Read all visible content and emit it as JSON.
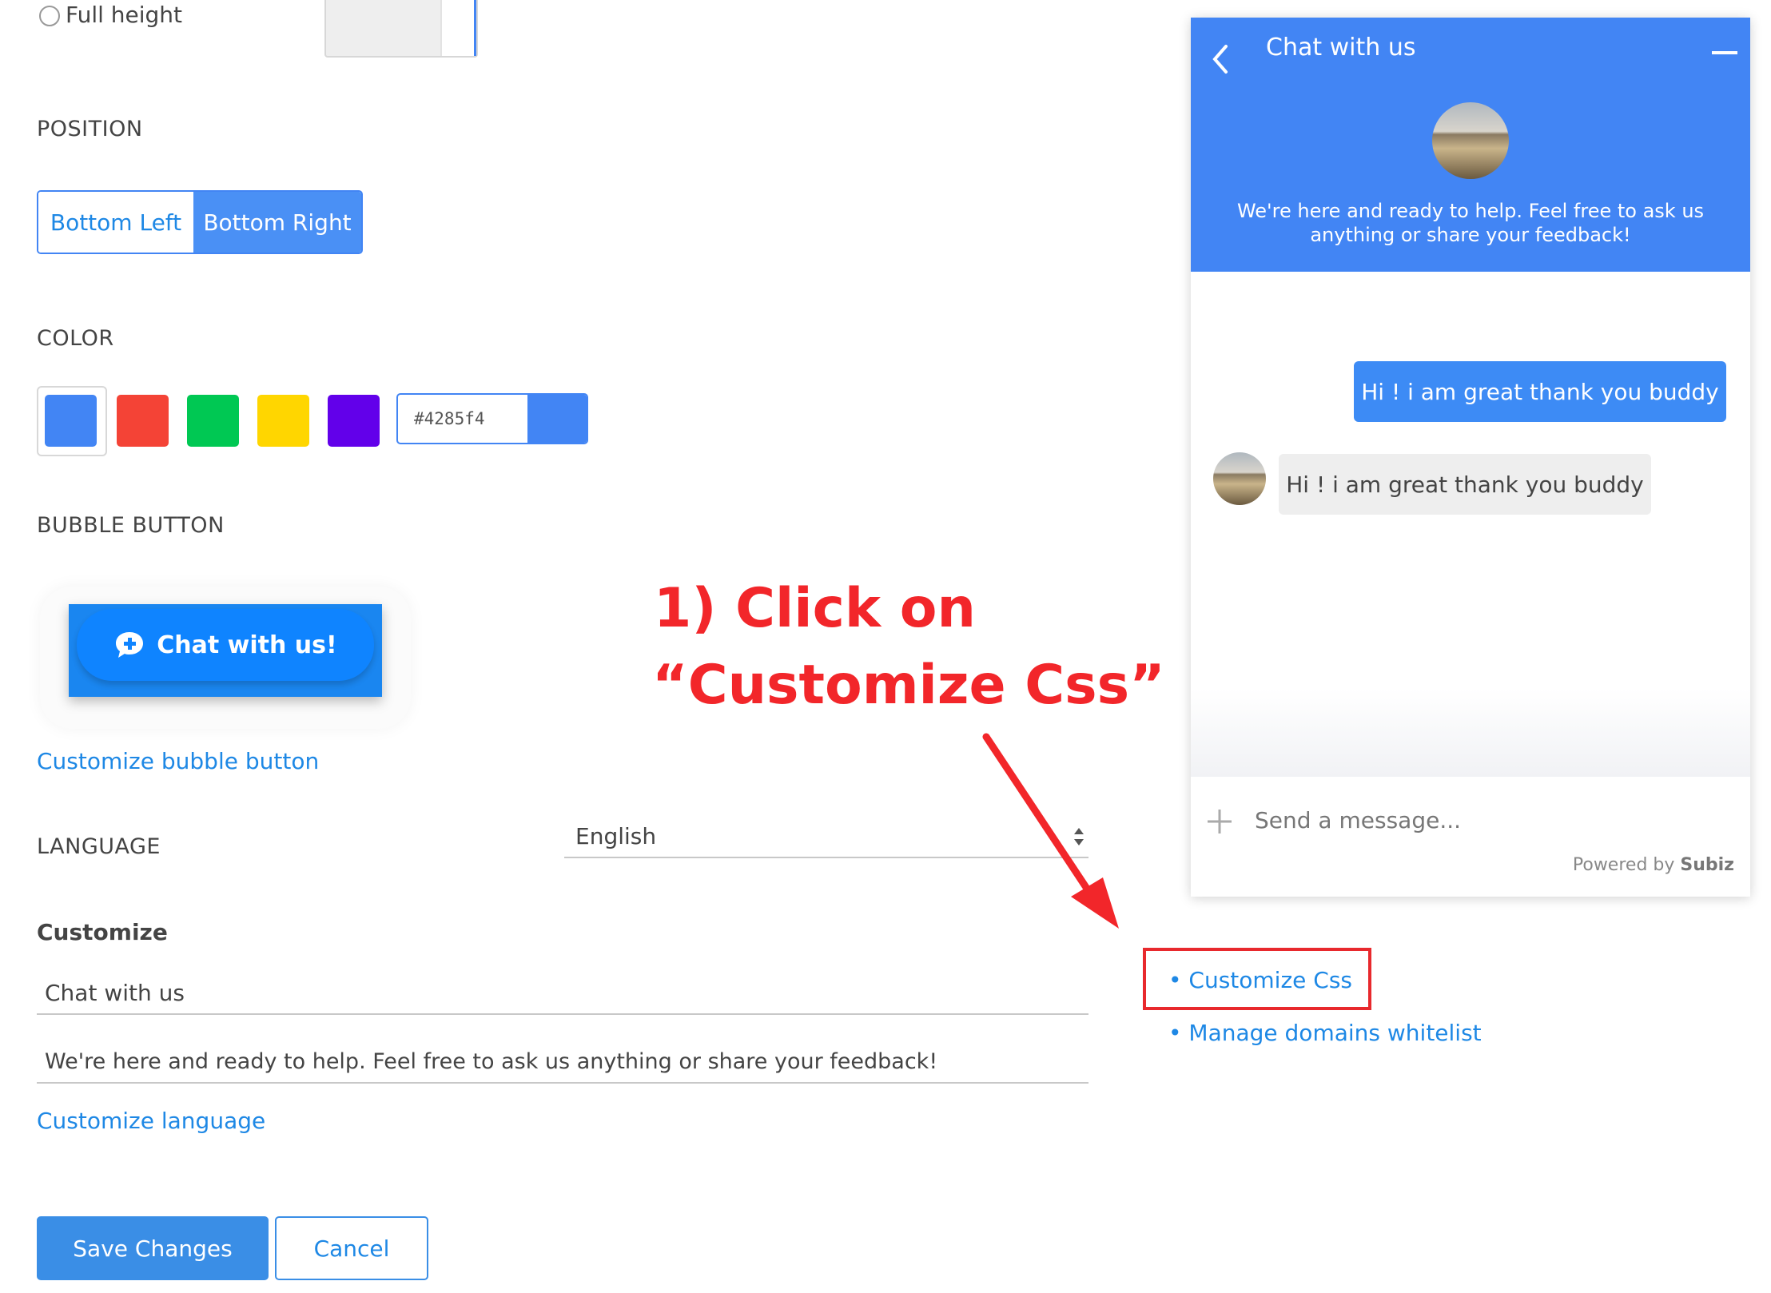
{
  "appearance": {
    "full_height_label": "Full height",
    "position": {
      "heading": "POSITION",
      "options": [
        "Bottom Left",
        "Bottom Right"
      ],
      "selected": "Bottom Right"
    },
    "color": {
      "heading": "COLOR",
      "swatches": [
        "#4285f4",
        "#f44336",
        "#00c853",
        "#ffd600",
        "#6200ea"
      ],
      "selected": "#4285f4",
      "hex_value": "#4285f4"
    },
    "bubble": {
      "heading": "BUBBLE BUTTON",
      "button_label": "Chat with us!",
      "customize_link": "Customize bubble button"
    },
    "language": {
      "heading": "LANGUAGE",
      "selected": "English"
    },
    "customize": {
      "heading": "Customize",
      "title_value": "Chat with us",
      "subtitle_value": "We're here and ready to help. Feel free to ask us anything or share your feedback!",
      "customize_language_link": "Customize language"
    },
    "actions": {
      "save_label": "Save Changes",
      "cancel_label": "Cancel"
    }
  },
  "side_links": {
    "customize_css": "• Customize Css",
    "manage_domains": "• Manage domains whitelist"
  },
  "annotation": {
    "line1": "1) Click on",
    "line2": "“Customize Css”"
  },
  "widget": {
    "title": "Chat with us",
    "greeting_line1": "We're here and ready to help. Feel free to ask us",
    "greeting_line2": "anything or share your feedback!",
    "messages": [
      {
        "from": "user",
        "text": "Hi ! i am great thank you buddy"
      },
      {
        "from": "agent",
        "text": "Hi ! i am great thank you buddy"
      }
    ],
    "input_placeholder": "Send a message...",
    "powered_by_prefix": "Powered by",
    "powered_by_brand": "Subiz"
  },
  "colors": {
    "accent": "#4285f4",
    "link": "#1e88e5",
    "annotation": "#f2262a"
  }
}
